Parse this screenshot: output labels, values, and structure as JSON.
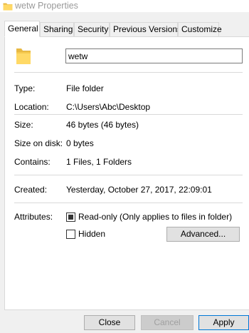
{
  "window": {
    "title": "wetw Properties"
  },
  "tabs": [
    {
      "label": "General",
      "active": true
    },
    {
      "label": "Sharing"
    },
    {
      "label": "Security"
    },
    {
      "label": "Previous Versions"
    },
    {
      "label": "Customize"
    }
  ],
  "general": {
    "name_value": "wetw",
    "fields": {
      "type": {
        "label": "Type:",
        "value": "File folder"
      },
      "location": {
        "label": "Location:",
        "value": "C:\\Users\\Abc\\Desktop"
      },
      "size": {
        "label": "Size:",
        "value": "46 bytes (46 bytes)"
      },
      "size_on_disk": {
        "label": "Size on disk:",
        "value": "0 bytes"
      },
      "contains": {
        "label": "Contains:",
        "value": "1 Files, 1 Folders"
      },
      "created": {
        "label": "Created:",
        "value": "Yesterday, October 27, 2017, 22:09:01"
      }
    },
    "attributes": {
      "label": "Attributes:",
      "readonly": {
        "label": "Read-only (Only applies to files in folder)",
        "state": "indeterminate"
      },
      "hidden": {
        "label": "Hidden",
        "state": "unchecked"
      },
      "advanced_button": "Advanced..."
    }
  },
  "buttons": {
    "close": "Close",
    "cancel": "Cancel",
    "apply": "Apply"
  },
  "icons": {
    "folder": "folder-icon",
    "folder_color": "#ffd966"
  }
}
